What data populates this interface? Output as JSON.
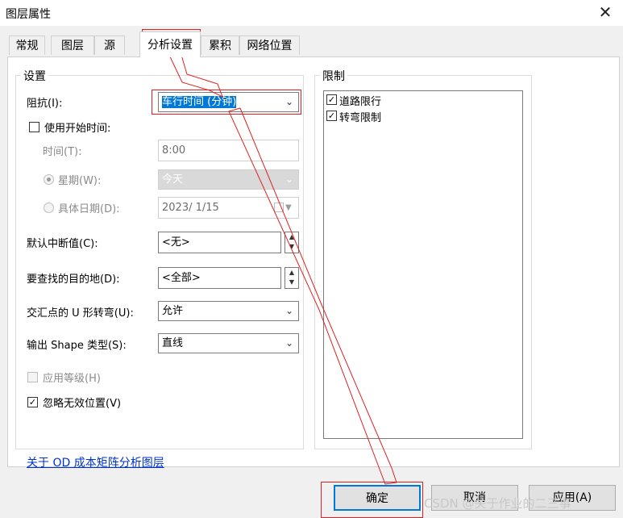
{
  "window": {
    "title": "图层属性",
    "close_glyph": "✕"
  },
  "tabs": [
    "常规",
    "图层",
    "源",
    "分析设置",
    "累积",
    "网络位置"
  ],
  "settings": {
    "group_label": "设置",
    "impedance_label": "阻抗(I):",
    "impedance_value": "车行时间 (分钟)",
    "use_start_time_label": "使用开始时间:",
    "time_label": "时间(T):",
    "time_value": "8:00",
    "weekday_label": "星期(W):",
    "weekday_value": "今天",
    "date_label": "具体日期(D):",
    "date_value": "2023/  1/15",
    "default_cutoff_label": "默认中断值(C):",
    "default_cutoff_value": "<无>",
    "destinations_label": "要查找的目的地(D):",
    "destinations_value": "<全部>",
    "uturn_label": "交汇点的 U 形转弯(U):",
    "uturn_value": "允许",
    "shape_label": "输出 Shape 类型(S):",
    "shape_value": "直线",
    "use_hierarchy_label": "应用等级(H)",
    "ignore_invalid_label": "忽略无效位置(V)"
  },
  "restrictions": {
    "group_label": "限制",
    "items": [
      {
        "label": "道路限行",
        "checked": true
      },
      {
        "label": "转弯限制",
        "checked": true
      }
    ]
  },
  "link_text": "关于 OD 成本矩阵分析图层",
  "buttons": {
    "ok": "确定",
    "cancel": "取消",
    "apply": "应用(A)"
  },
  "watermark": "CSDN @关于作业的二三事",
  "colors": {
    "annotation_red": "#e02020",
    "selection_blue": "#0078d7",
    "link_blue": "#0033cc"
  }
}
